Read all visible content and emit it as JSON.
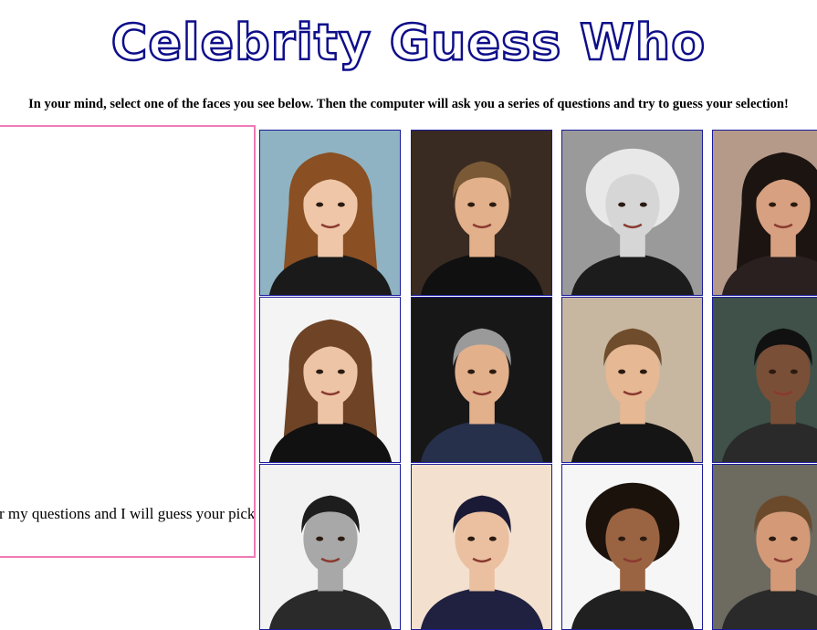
{
  "header": {
    "title": "Celebrity Guess Who",
    "instructions": "In your mind, select one of the faces you see below. Then the computer will ask you a series of questions and try to guess your selection!"
  },
  "panel": {
    "prompt": "ver my questions and I will guess your pick!"
  },
  "colors": {
    "title_outline": "#0d0d8a",
    "panel_border": "#f07ab6",
    "card_border": "#1a1a9c"
  },
  "faces": [
    {
      "bg": "#8fb3c2",
      "hair": "#8a4f23",
      "skin": "#efc7a8",
      "cloth": "#1a1a1a",
      "style": "long"
    },
    {
      "bg": "#3a2b22",
      "hair": "#7a5a36",
      "skin": "#e2b08a",
      "cloth": "#101010",
      "style": "short"
    },
    {
      "bg": "#9a9a9a",
      "hair": "#e8e8e8",
      "skin": "#d6d6d6",
      "cloth": "#1c1c1c",
      "style": "curly"
    },
    {
      "bg": "#b59a8a",
      "hair": "#1c1410",
      "skin": "#d7a080",
      "cloth": "#2a2020",
      "style": "long"
    },
    {
      "bg": "#f4f4f4",
      "hair": "#6e4326",
      "skin": "#eec4a6",
      "cloth": "#111111",
      "style": "long"
    },
    {
      "bg": "#171717",
      "hair": "#9a9a9a",
      "skin": "#e3b08c",
      "cloth": "#26304a",
      "style": "short"
    },
    {
      "bg": "#c8b7a0",
      "hair": "#6f4d2c",
      "skin": "#e6b894",
      "cloth": "#151515",
      "style": "short"
    },
    {
      "bg": "#3f5148",
      "hair": "#111111",
      "skin": "#7a4f37",
      "cloth": "#2a2a2a",
      "style": "short"
    },
    {
      "bg": "#f2f2f2",
      "hair": "#1d1d1d",
      "skin": "#a8a8a8",
      "cloth": "#2a2a2a",
      "style": "short"
    },
    {
      "bg": "#f3e0cf",
      "hair": "#1a1a36",
      "skin": "#eac0a0",
      "cloth": "#202040",
      "style": "short"
    },
    {
      "bg": "#f6f6f6",
      "hair": "#1c120c",
      "skin": "#9a6443",
      "cloth": "#202020",
      "style": "curly"
    },
    {
      "bg": "#6d6a60",
      "hair": "#6b4a2c",
      "skin": "#d49a78",
      "cloth": "#2a2a2a",
      "style": "short"
    }
  ]
}
